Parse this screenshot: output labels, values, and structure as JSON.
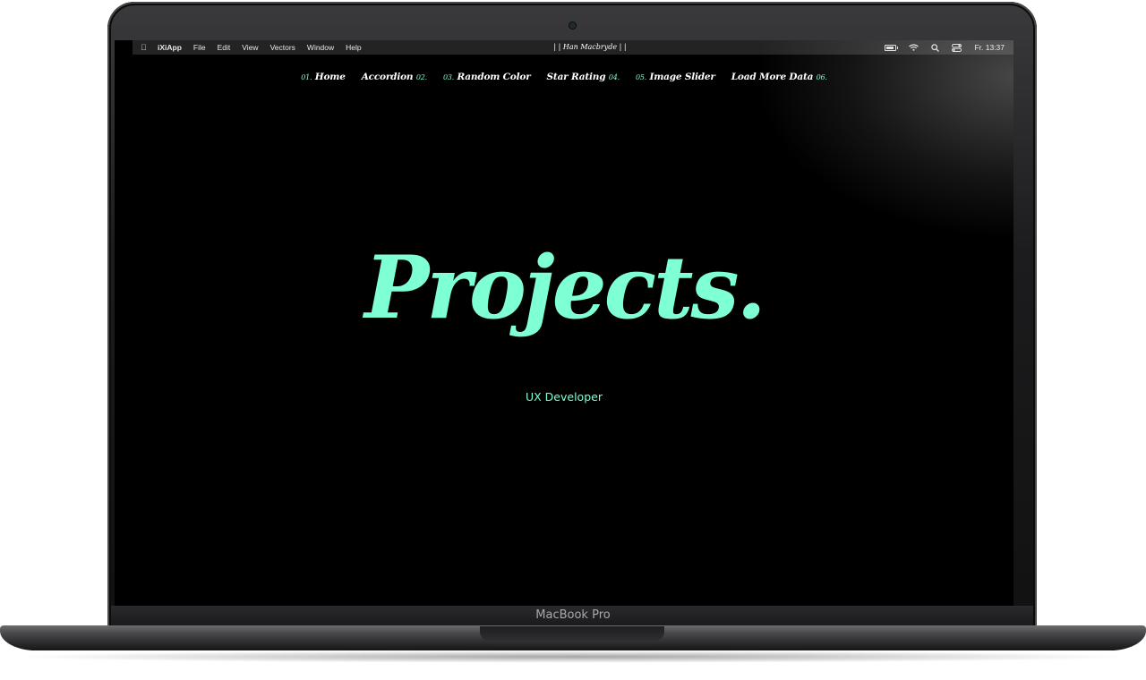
{
  "device": {
    "brand_label": "MacBook Pro"
  },
  "menubar": {
    "apple_icon": "apple-icon",
    "menus": [
      "iXiApp",
      "File",
      "Edit",
      "View",
      "Vectors",
      "Window",
      "Help"
    ],
    "center_title": "| | Han Macbryde | |",
    "status_icons": [
      "battery-icon",
      "wifi-icon",
      "search-icon",
      "control-center-icon"
    ],
    "clock": "Fr. 13:37"
  },
  "nav": {
    "items": [
      {
        "num": "01.",
        "label": "Home"
      },
      {
        "num": "02.",
        "label": "Accordion"
      },
      {
        "num": "03.",
        "label": "Random Color"
      },
      {
        "num": "04.",
        "label": "Star Rating"
      },
      {
        "num": "05.",
        "label": "Image Slider"
      },
      {
        "num": "06.",
        "label": "Load More Data"
      }
    ]
  },
  "hero": {
    "title": "Projects.",
    "subtitle": "UX Developer"
  },
  "colors": {
    "accent": "#7fffd4",
    "background": "#000000",
    "text": "#ffffff"
  }
}
